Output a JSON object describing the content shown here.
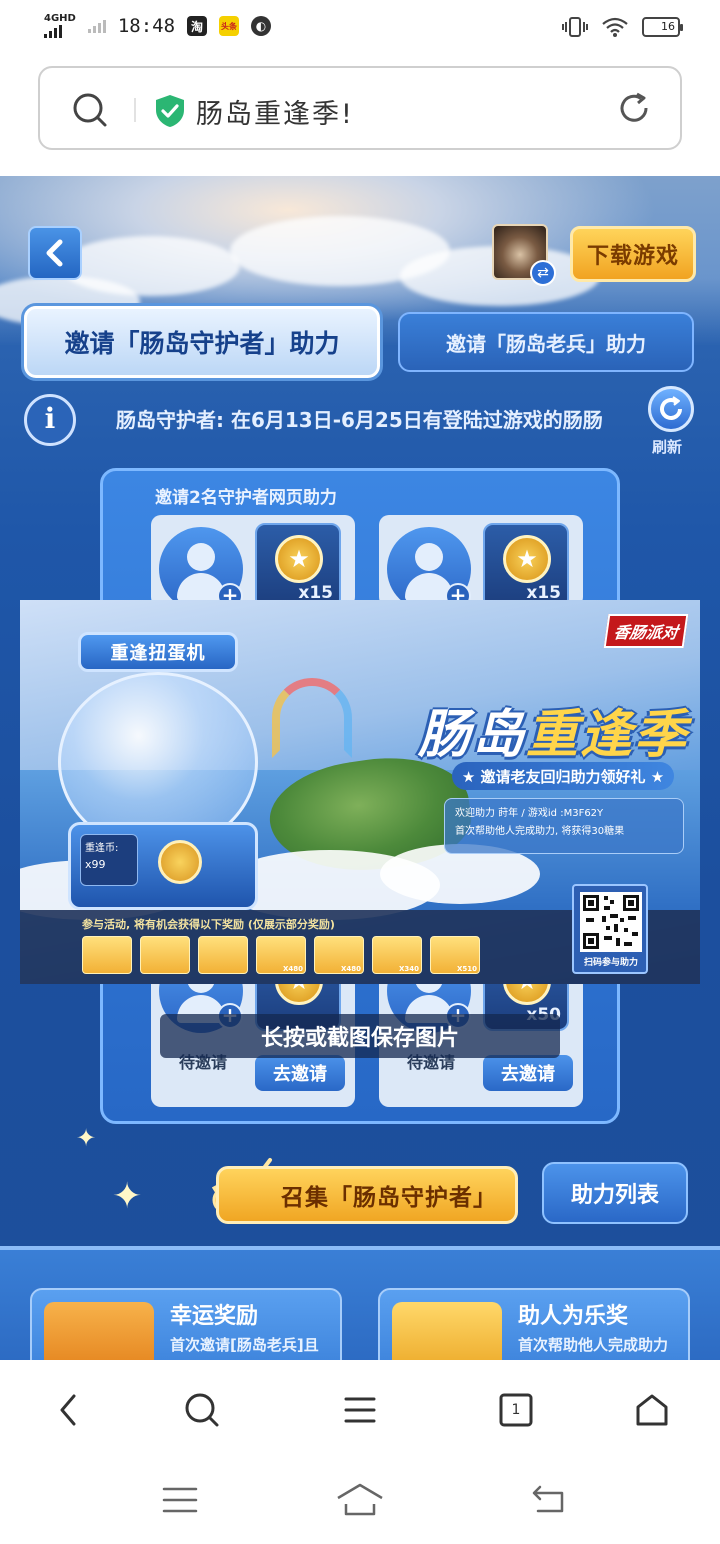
{
  "status_bar": {
    "network": "4GHD",
    "time": "18:48",
    "apps": [
      {
        "name": "taobao-icon",
        "glyph": "淘",
        "bg": "#222222",
        "fg": "#ffffff"
      },
      {
        "name": "hotspot-icon",
        "glyph": "头条",
        "bg": "#f5d000",
        "fg": "#c81e1e"
      },
      {
        "name": "compass-icon",
        "glyph": "◐",
        "bg": "#333333",
        "fg": "#ffffff"
      }
    ],
    "battery": "16"
  },
  "url_bar": {
    "title": "肠岛重逢季!",
    "accent": "#2bb673"
  },
  "header": {
    "download_label": "下载游戏",
    "switch_glyph": "⇄"
  },
  "tabs": [
    {
      "label": "邀请「肠岛守护者」助力",
      "active": true
    },
    {
      "label": "邀请「肠岛老兵」助力",
      "active": false
    }
  ],
  "info": {
    "glyph": "i",
    "description": "肠岛守护者: 在6月13日-6月25日有登陆过游戏的肠肠",
    "refresh_label": "刷新"
  },
  "panel": {
    "title": "邀请2名守护者网页助力",
    "slots_top": [
      {
        "qty": "x15"
      },
      {
        "qty": "x15"
      }
    ],
    "slots_bottom": [
      {
        "qty": "",
        "status": "待邀请",
        "button": "去邀请"
      },
      {
        "qty": "x50",
        "status": "待邀请",
        "button": "去邀请"
      }
    ],
    "plus_glyph": "+",
    "coin_glyph": "★"
  },
  "poster": {
    "machine_label": "重逢扭蛋机",
    "price_label": "重逢币:",
    "price_value": "x99",
    "brand": "香肠派对",
    "title_a": "肠岛",
    "title_b": "重逢季",
    "subtitle": "★ 邀请老友回归助力领好礼 ★",
    "welcome_line1": "欢迎助力 莳年 / 游戏id :M3F62Y",
    "welcome_line2": "首次帮助他人完成助力, 将获得30糖果",
    "rewards_caption": "参与活动, 将有机会获得以下奖励 (仅展示部分奖励)",
    "reward_items": [
      "",
      "",
      "",
      "X480",
      "X480",
      "X340",
      "X510"
    ],
    "qr_caption": "扫码参与助力"
  },
  "save_hint": "长按或截图保存图片",
  "actions": {
    "call_label": "召集「肠岛守护者」",
    "list_label": "助力列表"
  },
  "reward_cards": [
    {
      "name": "幸运奖励",
      "sub": "首次邀请[肠岛老兵]且"
    },
    {
      "name": "助人为乐奖",
      "sub": "首次帮助他人完成助力"
    }
  ],
  "browser_nav": {
    "tab_count": "1"
  }
}
